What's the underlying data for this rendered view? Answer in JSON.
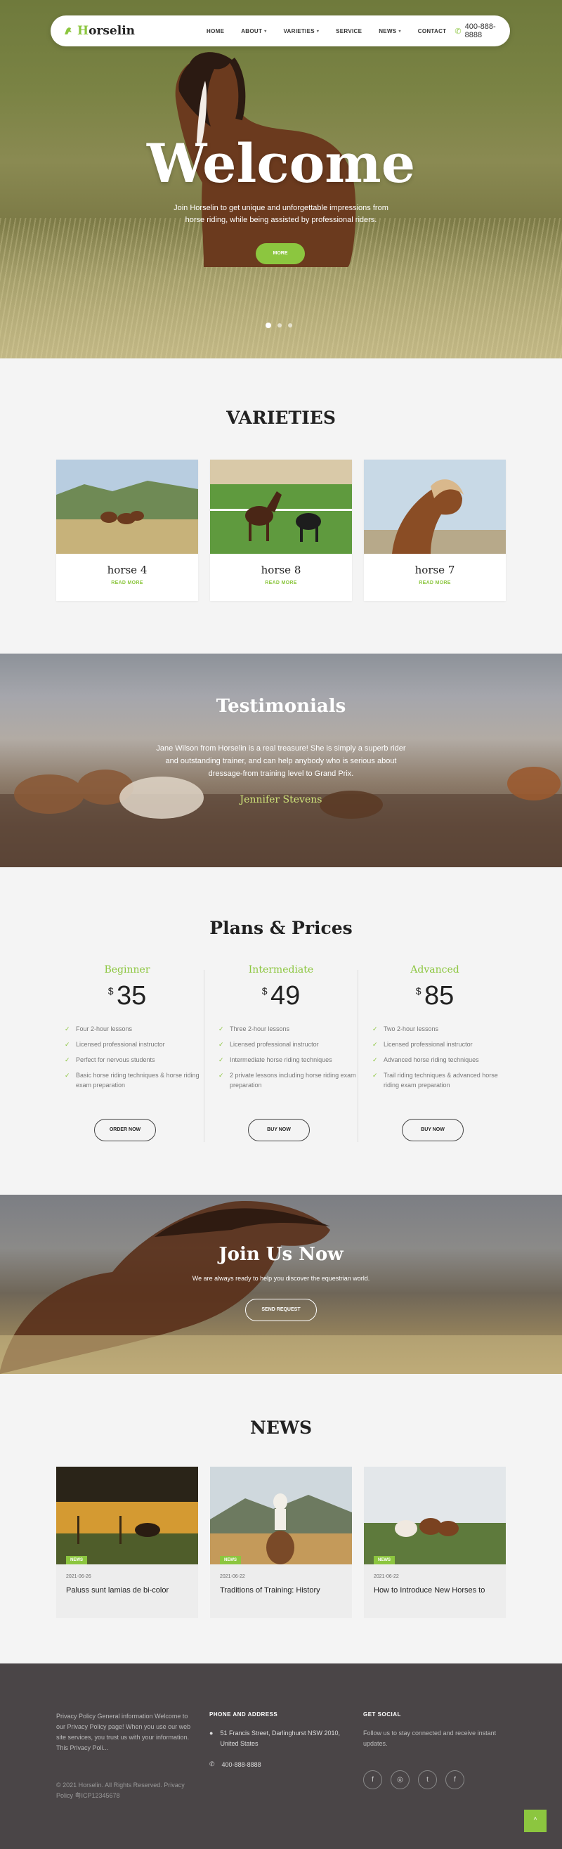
{
  "brand": {
    "prefix": "H",
    "rest": "orselin"
  },
  "nav": {
    "items": [
      {
        "label": "HOME",
        "dropdown": false
      },
      {
        "label": "ABOUT",
        "dropdown": true
      },
      {
        "label": "VARIETIES",
        "dropdown": true
      },
      {
        "label": "SERVICE",
        "dropdown": false
      },
      {
        "label": "NEWS",
        "dropdown": true
      },
      {
        "label": "CONTACT",
        "dropdown": false
      }
    ],
    "phone": "400-888-8888"
  },
  "hero": {
    "title": "Welcome",
    "sub_line1": "Join Horselin to get unique and unforgettable impressions from",
    "sub_line2": "horse riding, while being assisted by professional riders.",
    "button": "MORE",
    "slides_count": 3,
    "active_slide": 1
  },
  "varieties": {
    "title": "VARIETIES",
    "items": [
      {
        "name": "horse 4",
        "link": "READ MORE"
      },
      {
        "name": "horse 8",
        "link": "READ MORE"
      },
      {
        "name": "horse 7",
        "link": "READ MORE"
      }
    ]
  },
  "testimonials": {
    "title": "Testimonials",
    "line1": "Jane Wilson from Horselin is a real treasure! She is simply a superb rider",
    "line2": "and outstanding trainer, and can help anybody who is serious about",
    "line3": "dressage-from training level to Grand Prix.",
    "author": "Jennifer Stevens"
  },
  "plans": {
    "title": "Plans & Prices",
    "currency": "$",
    "items": [
      {
        "name": "Beginner",
        "price": "35",
        "features": [
          "Four 2-hour lessons",
          "Licensed professional instructor",
          "Perfect for nervous students",
          "Basic horse riding techniques & horse riding exam preparation"
        ],
        "button": "ORDER NOW"
      },
      {
        "name": "Intermediate",
        "price": "49",
        "features": [
          "Three 2-hour lessons",
          "Licensed professional instructor",
          "Intermediate horse riding techniques",
          "2 private lessons including horse riding exam preparation"
        ],
        "button": "BUY NOW"
      },
      {
        "name": "Advanced",
        "price": "85",
        "features": [
          "Two 2-hour lessons",
          "Licensed professional instructor",
          "Advanced horse riding techniques",
          "Trail riding techniques & advanced horse riding exam preparation"
        ],
        "button": "BUY NOW"
      }
    ]
  },
  "join": {
    "title": "Join Us Now",
    "sub": "We are always ready to help you discover the equestrian world.",
    "button": "SEND REQUEST"
  },
  "news": {
    "title": "NEWS",
    "items": [
      {
        "tag": "NEWS",
        "date": "2021-06-26",
        "title": "Paluss sunt lamias de bi-color"
      },
      {
        "tag": "NEWS",
        "date": "2021-06-22",
        "title": "Traditions of Training: History"
      },
      {
        "tag": "NEWS",
        "date": "2021-06-22",
        "title": "How to Introduce New Horses to"
      }
    ]
  },
  "footer": {
    "about": "Privacy Policy General information Welcome to our Privacy Policy page! When you use our web site services, you trust us with your information. This Privacy Poli...",
    "copyright": "© 2021 Horselin. All Rights Reserved. Privacy Policy 粤ICP12345678",
    "address_heading": "PHONE AND ADDRESS",
    "address": "51 Francis Street, Darlinghurst NSW 2010, United States",
    "phone": "400-888-8888",
    "social_heading": "GET SOCIAL",
    "social_text": "Follow us to stay connected and receive instant updates.",
    "socials": [
      {
        "icon": "facebook-icon",
        "glyph": "f"
      },
      {
        "icon": "instagram-icon",
        "glyph": "◎"
      },
      {
        "icon": "twitter-icon",
        "glyph": "t"
      },
      {
        "icon": "facebook-icon",
        "glyph": "f"
      }
    ],
    "to_top": "^"
  },
  "colors": {
    "accent": "#8cc63f",
    "footer_bg": "#4a4547",
    "page_bg": "#f4f4f4"
  }
}
